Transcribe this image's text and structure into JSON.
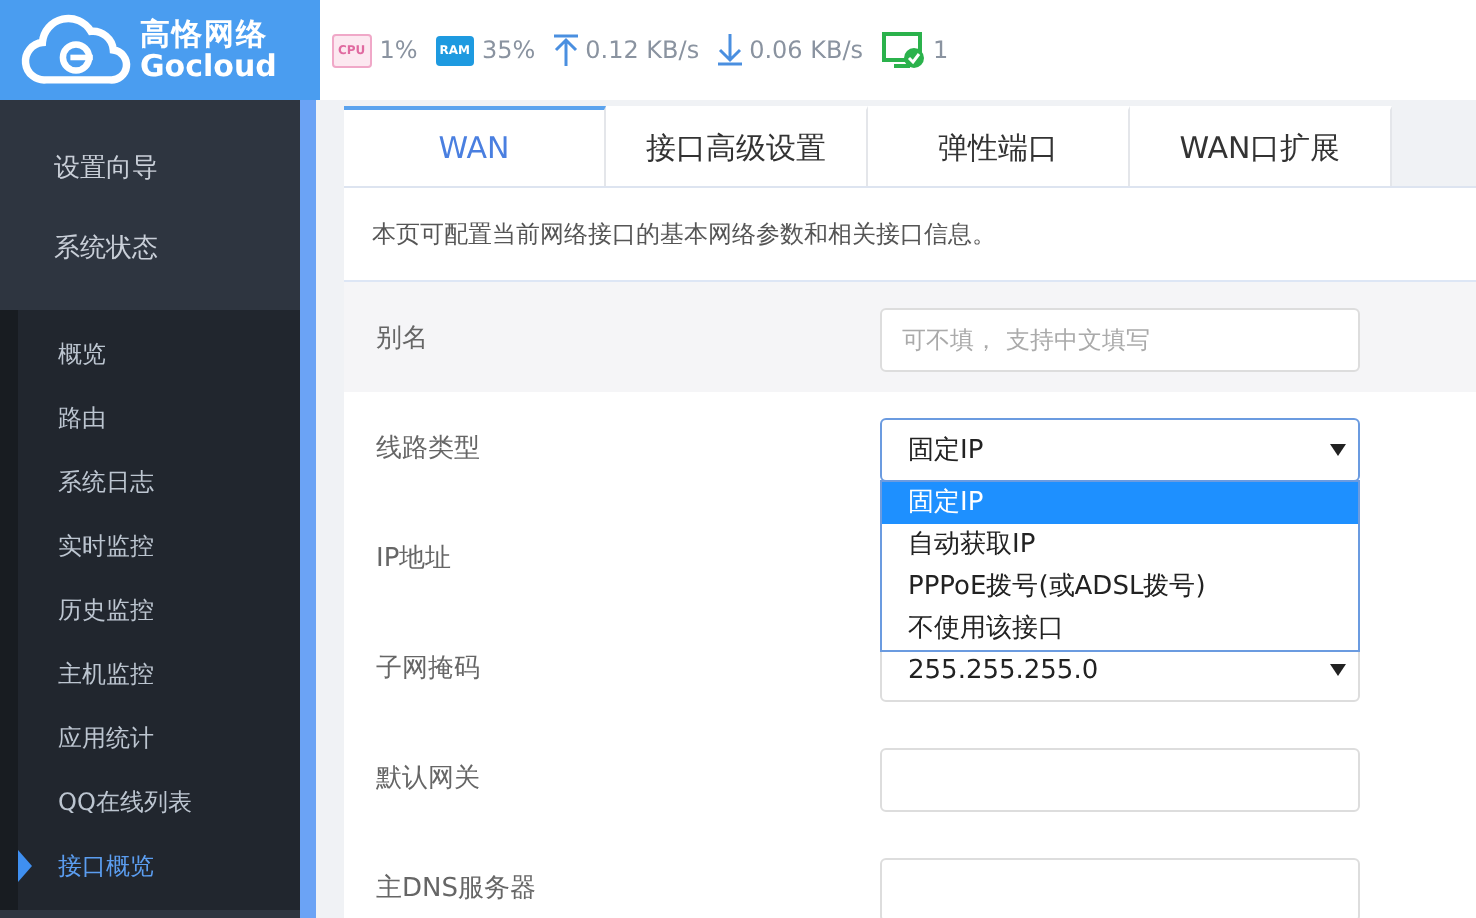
{
  "logo": {
    "name": "高恪网络",
    "brand": "Gocloud"
  },
  "status_bar": [
    {
      "kind": "cpu",
      "icon_text": "CPU",
      "value": "1%"
    },
    {
      "kind": "ram",
      "icon_text": "RAM",
      "value": "35%"
    },
    {
      "kind": "upload",
      "value": "0.12 KB/s"
    },
    {
      "kind": "download",
      "value": "0.06 KB/s"
    },
    {
      "kind": "clients",
      "value": "1"
    }
  ],
  "sidebar": {
    "items": [
      {
        "label": "设置向导"
      },
      {
        "label": "系统状态",
        "children": [
          {
            "label": "概览",
            "selected": false
          },
          {
            "label": "路由",
            "selected": false
          },
          {
            "label": "系统日志",
            "selected": false
          },
          {
            "label": "实时监控",
            "selected": false
          },
          {
            "label": "历史监控",
            "selected": false
          },
          {
            "label": "主机监控",
            "selected": false
          },
          {
            "label": "应用统计",
            "selected": false
          },
          {
            "label": "QQ在线列表",
            "selected": false
          },
          {
            "label": "接口概览",
            "selected": true
          }
        ]
      }
    ]
  },
  "tabs": [
    {
      "label": "WAN",
      "selected": true
    },
    {
      "label": "接口高级设置",
      "selected": false
    },
    {
      "label": "弹性端口",
      "selected": false
    },
    {
      "label": "WAN口扩展",
      "selected": false
    }
  ],
  "description": "本页可配置当前网络接口的基本网络参数和相关接口信息。",
  "fields": [
    {
      "label": "别名",
      "kind": "text",
      "placeholder": "可不填， 支持中文填写"
    },
    {
      "label": "线路类型",
      "kind": "select",
      "value": "固定IP",
      "expanded": true,
      "options": [
        {
          "label": "固定IP",
          "selected": true
        },
        {
          "label": "自动获取IP",
          "selected": false
        },
        {
          "label": "PPPoE拨号(或ADSL拨号)",
          "selected": false
        },
        {
          "label": "不使用该接口",
          "selected": false
        }
      ]
    },
    {
      "label": "IP地址",
      "kind": "hidden"
    },
    {
      "label": "子网掩码",
      "kind": "select",
      "value": "255.255.255.0",
      "expanded": false
    },
    {
      "label": "默认网关",
      "kind": "text"
    },
    {
      "label": "主DNS服务器",
      "kind": "text"
    }
  ]
}
